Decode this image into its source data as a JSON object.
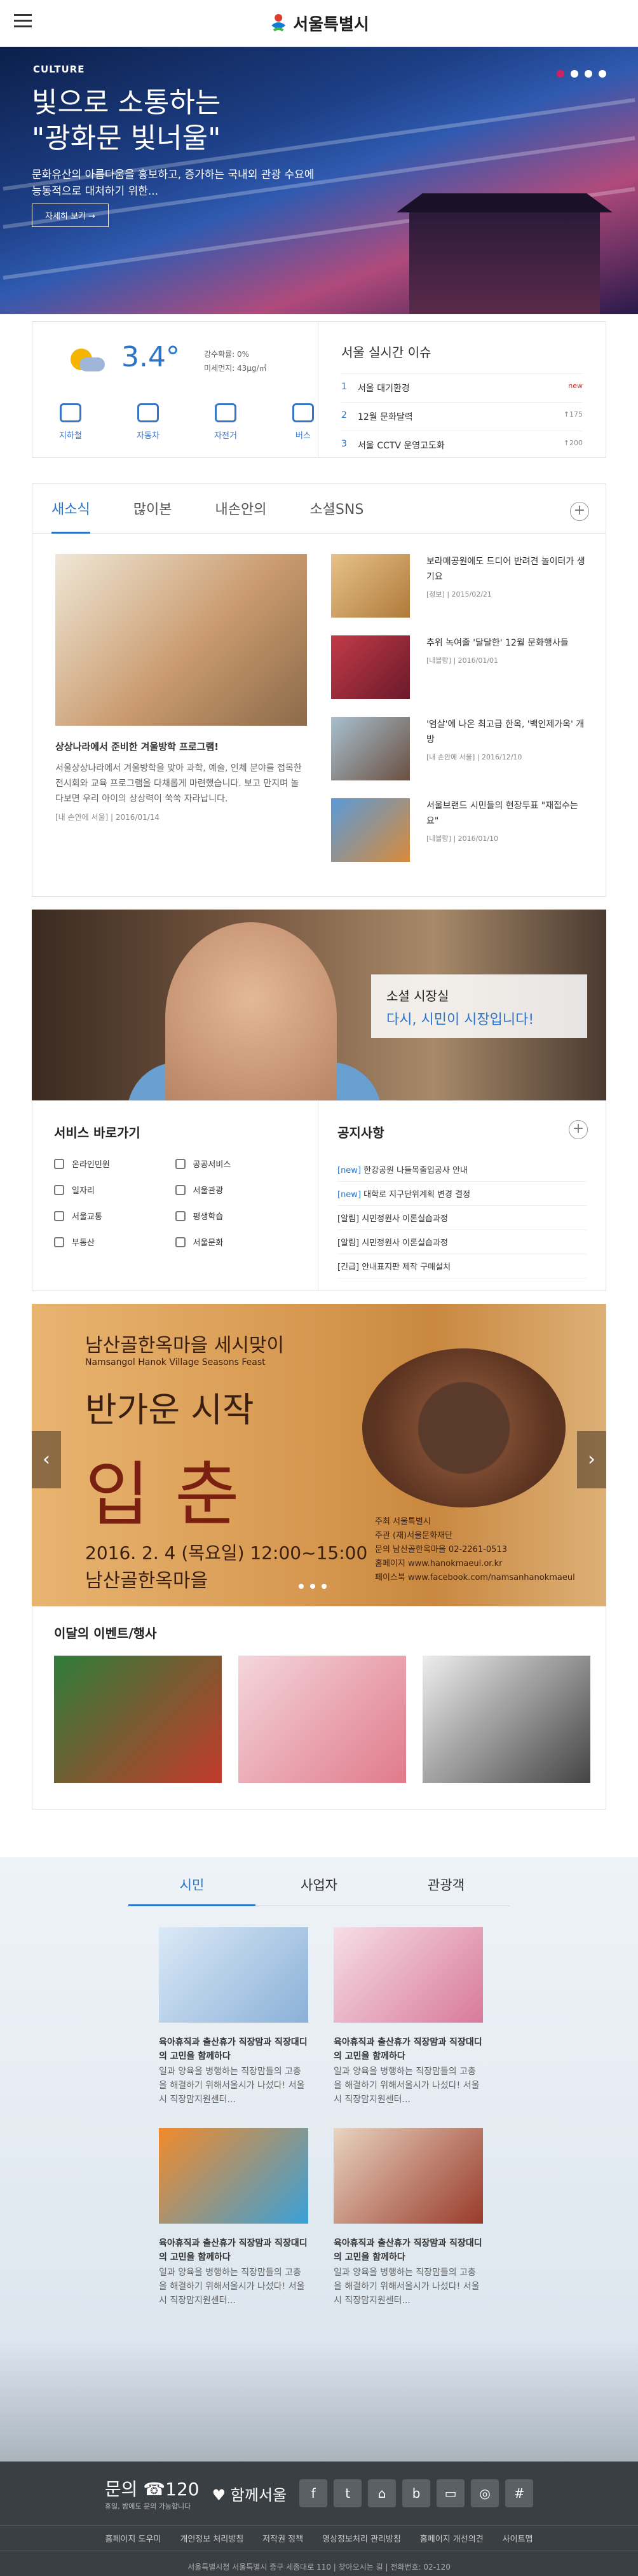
{
  "header": {
    "logo_text": "서울특별시"
  },
  "hero": {
    "tag": "CULTURE",
    "title_line1": "빛으로 소통하는",
    "title_line2": "\"광화문 빛너울\"",
    "desc": "문화유산의 아름다움을 홍보하고, 증가하는 국내외 관광 수요에 능동적으로 대처하기 위한...",
    "more": "자세히 보기 →"
  },
  "weather": {
    "temp": "3.4°",
    "rain": "강수확률: 0%",
    "dust": "미세먼지: 43μg/㎥",
    "transport": [
      "지하철",
      "자동차",
      "자전거",
      "버스"
    ]
  },
  "issues": {
    "title": "서울 실시간 이슈",
    "rows": [
      {
        "rank": "1",
        "label": "서울 대기환경",
        "change": "new"
      },
      {
        "rank": "2",
        "label": "12월 문화달력",
        "change": "↑175"
      },
      {
        "rank": "3",
        "label": "서울 CCTV 운영고도화",
        "change": "↑200"
      }
    ]
  },
  "news": {
    "tabs": [
      "새소식",
      "많이본",
      "내손안의",
      "소셜SNS"
    ],
    "feature": {
      "title": "상상나라에서 준비한 겨울방학 프로그램!",
      "body": "서울상상나라에서 겨울방학을 맞아 과학, 예술, 인체 분야를 접목한 전시회와 교육 프로그램을 다채롭게 마련했습니다. 보고 만지며 놀다보면 우리 아이의 상상력이 쑥쑥 자라납니다.",
      "meta": "[내 손안에 서울] | 2016/01/14"
    },
    "items": [
      {
        "text": "보라매공원에도 드디어 반려견 놀이터가 생기요",
        "meta": "[정보] | 2015/02/21"
      },
      {
        "text": "추위 녹여줄 '달달한' 12월 문화행사들",
        "meta": "[내블랑] | 2016/01/01"
      },
      {
        "text": "'엄살'에 나온 최고급 한옥, '백인제가옥' 개방",
        "meta": "[내 손안에 서울] | 2016/12/10"
      },
      {
        "text": "서울브랜드 시민들의 현장투표 \"재접수는요\"",
        "meta": "[내블랑] | 2016/01/10"
      }
    ]
  },
  "mayor": {
    "title": "소셜 시장실",
    "subtitle": "다시, 시민이 시장입니다!"
  },
  "services": {
    "title": "서비스 바로가기",
    "items": [
      "온라인민원",
      "공공서비스",
      "일자리",
      "서울관광",
      "서울교통",
      "평생학습",
      "부동산",
      "서울문화"
    ]
  },
  "notice": {
    "title": "공지사항",
    "rows": [
      {
        "tag": "[new]",
        "text": "한강공원 나들목출입공사 안내"
      },
      {
        "tag": "[new]",
        "text": "대학로 지구단위계획 변경 결정"
      },
      {
        "tag": "[알림]",
        "text": "시민정원사 이론실습과정"
      },
      {
        "tag": "[알림]",
        "text": "시민정원사 이론실습과정"
      },
      {
        "tag": "[긴급]",
        "text": "안내표지판 제작 구매설치"
      }
    ]
  },
  "banner": {
    "line1": "남산골한옥마을 세시맞이",
    "line2": "Namsangol Hanok Village Seasons Feast",
    "line3": "반가운 시작",
    "line4": "입춘",
    "line5": "2016. 2. 4 (목요일) 12:00~15:00",
    "line6": "남산골한옥마을",
    "info": [
      "주최  서울특별시",
      "주관  (재)서울문화재단",
      "문의  남산골한옥마을 02-2261-0513",
      "홈페이지  www.hanokmaeul.or.kr",
      "페이스북  www.facebook.com/namsanhanokmaeul"
    ]
  },
  "events": {
    "title": "이달의 이벤트/행사"
  },
  "lower": {
    "tabs": [
      "시민",
      "사업자",
      "관광객"
    ],
    "cards": [
      {
        "head": "육아휴직과 출산휴가 직장맘과 직장대디의 고민을 함께하다",
        "body": "일과 양육을 병행하는 직장맘들의 고충을 해결하기 위해서울시가 나섰다! 서울시 직장맘지원센터..."
      },
      {
        "head": "육아휴직과 출산휴가 직장맘과 직장대디의 고민을 함께하다",
        "body": "일과 양육을 병행하는 직장맘들의 고충을 해결하기 위해서울시가 나섰다! 서울시 직장맘지원센터..."
      },
      {
        "head": "육아휴직과 출산휴가 직장맘과 직장대디의 고민을 함께하다",
        "body": "일과 양육을 병행하는 직장맘들의 고충을 해결하기 위해서울시가 나섰다! 서울시 직장맘지원센터..."
      },
      {
        "head": "육아휴직과 출산휴가 직장맘과 직장대디의 고민을 함께하다",
        "body": "일과 양육을 병행하는 직장맘들의 고충을 해결하기 위해서울시가 나섰다! 서울시 직장맘지원센터..."
      }
    ]
  },
  "footer": {
    "call": "문의 ☎120",
    "call_sub": "휴일, 밤에도 문의 가능합니다",
    "slogan": "함께서울",
    "links": [
      "홈페이지 도우미",
      "개인정보 처리방침",
      "저작권 정책",
      "영상정보처리 관리방침",
      "홈페이지 개선의견",
      "사이트맵"
    ],
    "copy": "서울특별시청 서울특별시 중구 세종대로 110 | 찾아오시는 길 | 전화번호: 02-120"
  }
}
